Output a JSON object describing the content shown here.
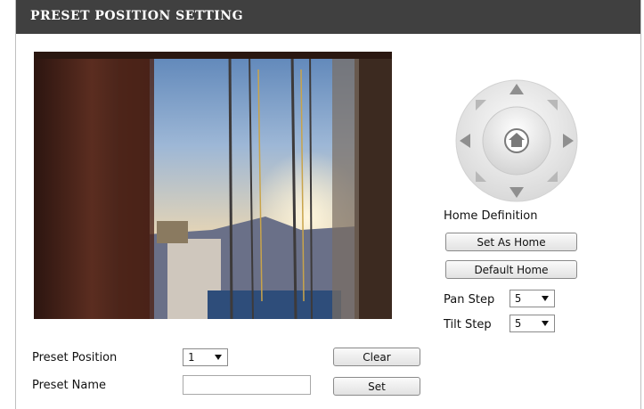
{
  "header": {
    "title": "PRESET POSITION SETTING"
  },
  "ptz": {
    "home_definition_label": "Home Definition",
    "set_as_home_label": "Set As Home",
    "default_home_label": "Default Home",
    "pan_step_label": "Pan Step",
    "pan_step_value": "5",
    "tilt_step_label": "Tilt Step",
    "tilt_step_value": "5"
  },
  "preset": {
    "position_label": "Preset Position",
    "position_value": "1",
    "name_label": "Preset Name",
    "name_value": "",
    "clear_label": "Clear",
    "set_label": "Set"
  }
}
